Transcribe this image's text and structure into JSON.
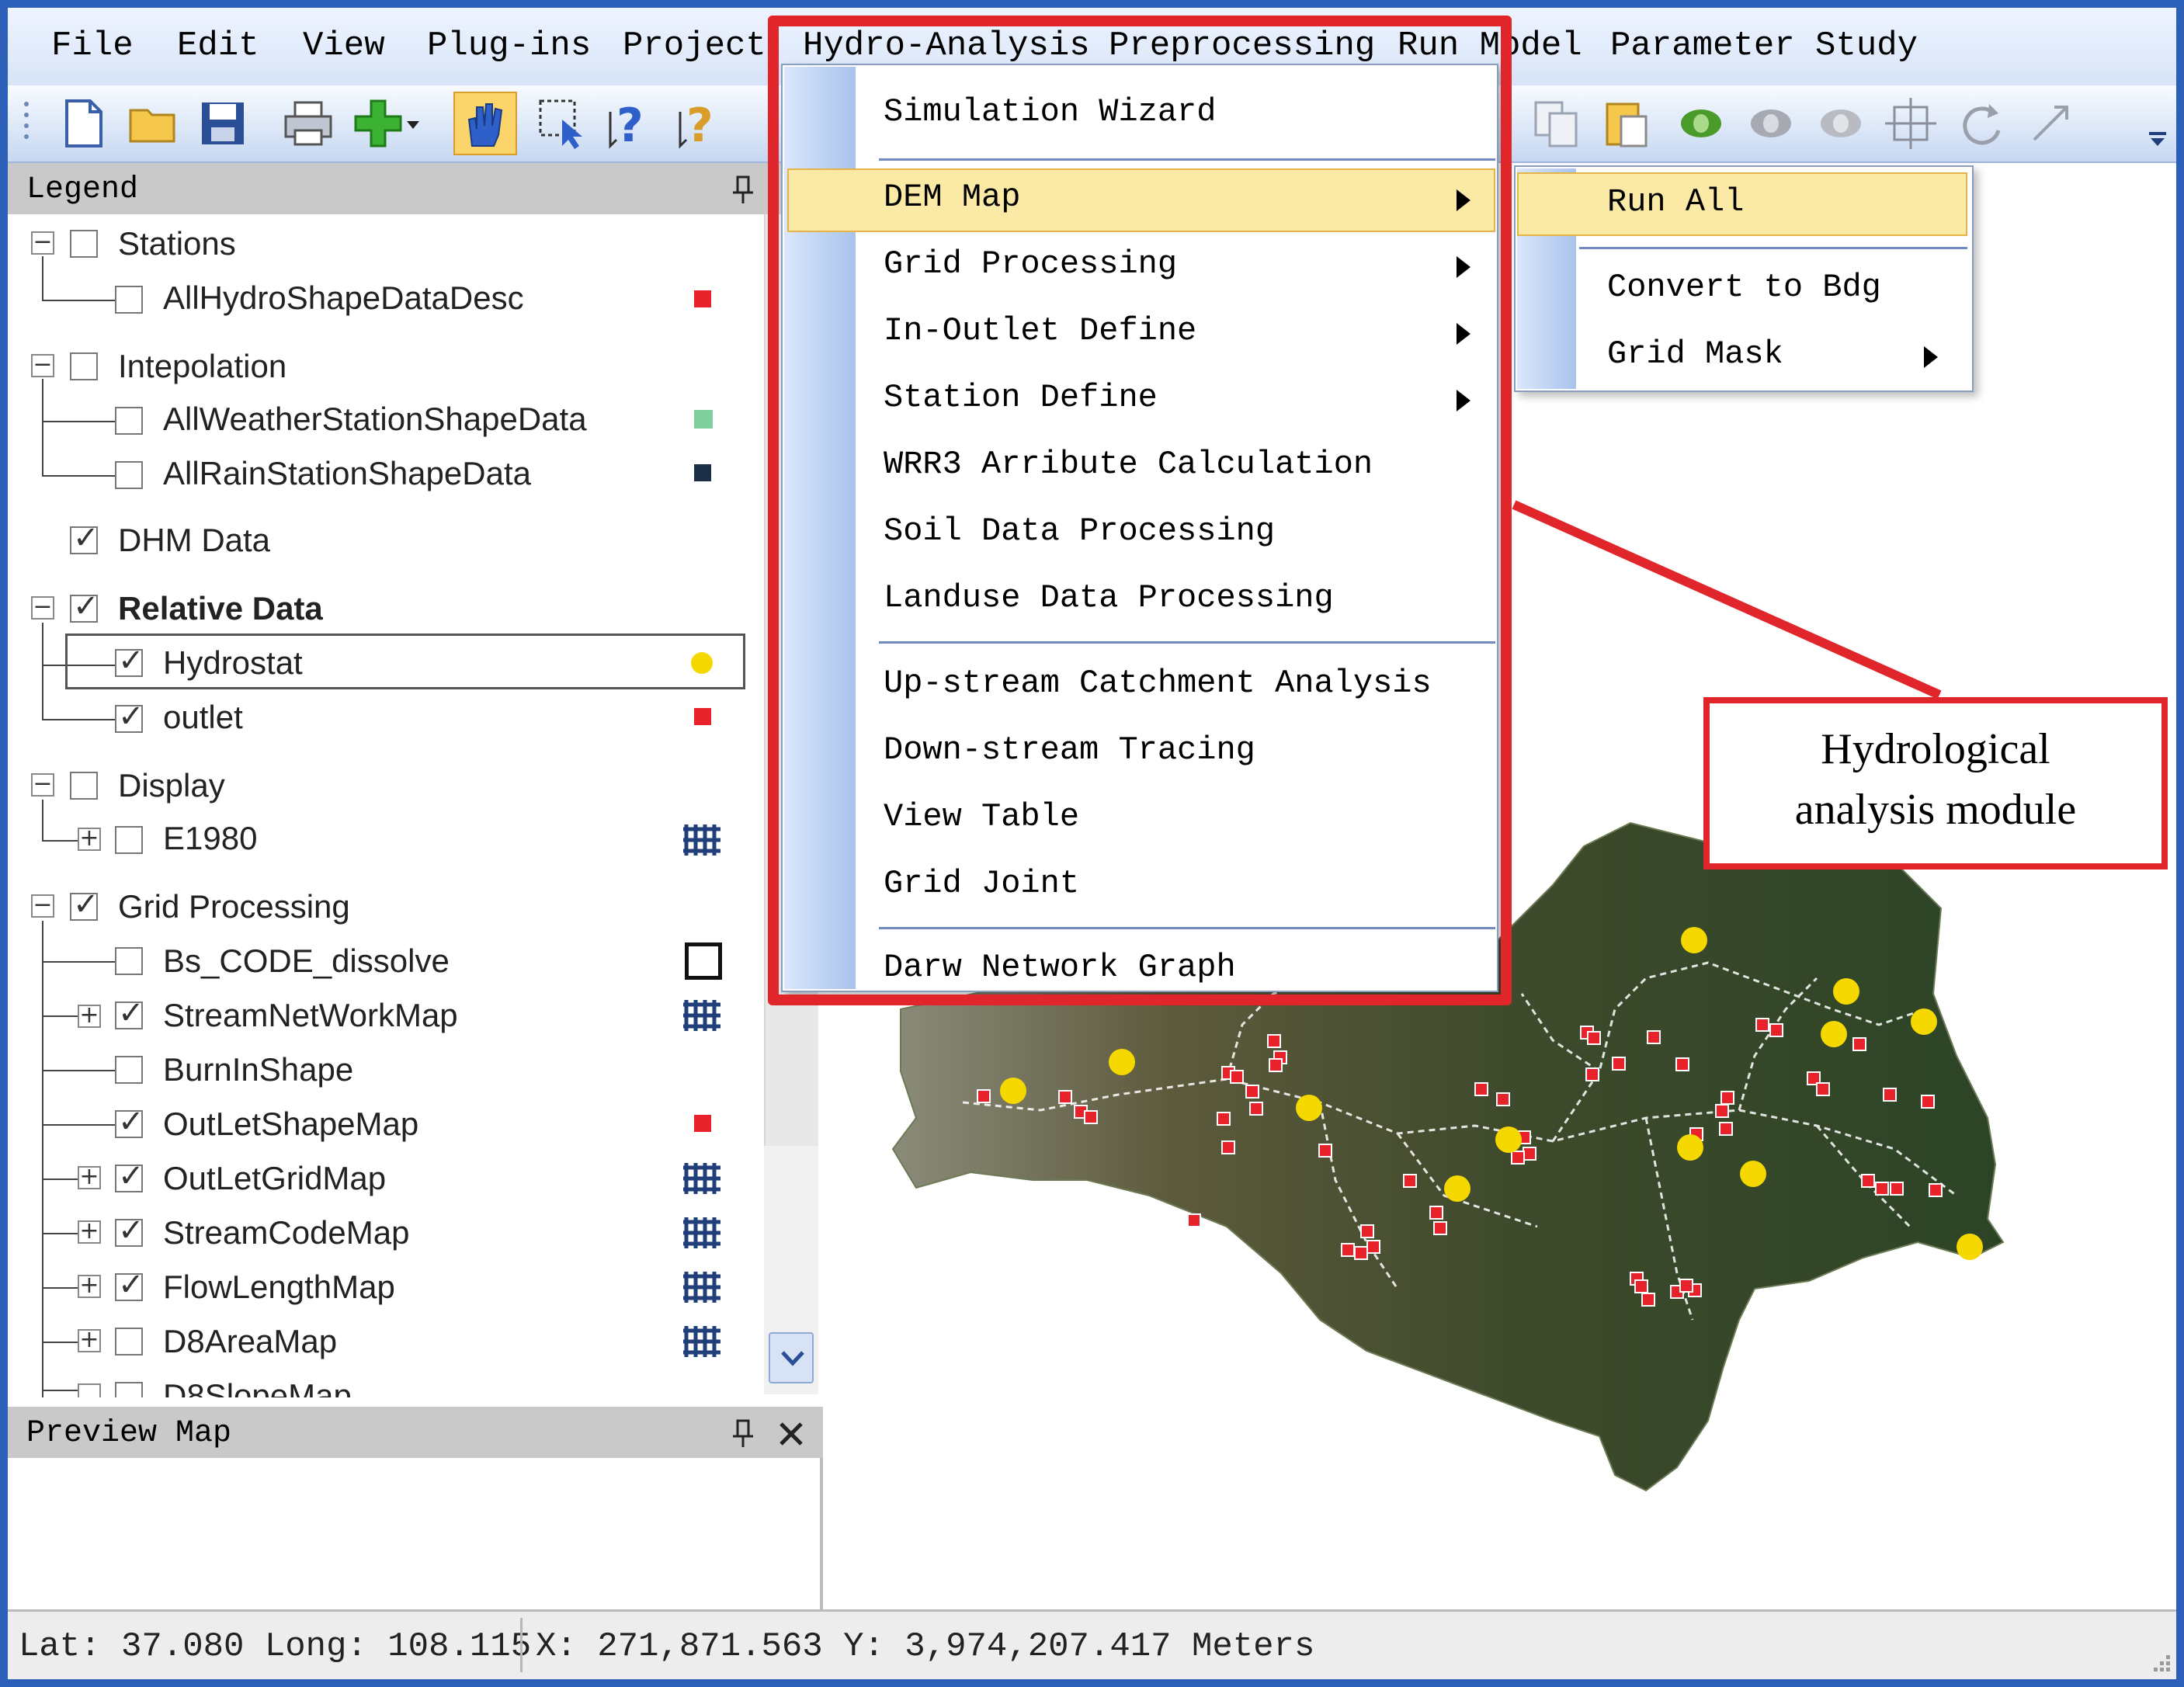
{
  "menubar": {
    "items": [
      "File",
      "Edit",
      "View",
      "Plug-ins",
      "Project",
      "Hydro-Analysis",
      "Preprocessing",
      "Run Model",
      "Parameter Study"
    ]
  },
  "legend": {
    "title": "Legend",
    "layers": {
      "stations": "Stations",
      "all_hydro": "AllHydroShapeDataDesc",
      "interpolation": "Intepolation",
      "all_weather": "AllWeatherStationShapeData",
      "all_rain": "AllRainStationShapeData",
      "dhm": "DHM Data",
      "relative": "Relative Data",
      "hydrostat": "Hydrostat",
      "outlet": "outlet",
      "display": "Display",
      "e1980": "E1980",
      "grid_processing": "Grid Processing",
      "bs_code": "Bs_CODE_dissolve",
      "stream_network": "StreamNetWorkMap",
      "burnin": "BurnInShape",
      "outlet_shape": "OutLetShapeMap",
      "outlet_grid": "OutLetGridMap",
      "stream_code": "StreamCodeMap",
      "flow_length": "FlowLengthMap",
      "d8area": "D8AreaMap",
      "d8slope": "D8SlopeMap"
    }
  },
  "preview": {
    "title": "Preview Map"
  },
  "dropdown": {
    "items": [
      "Simulation Wizard",
      "DEM Map",
      "Grid Processing",
      "In-Outlet Define",
      "Station Define",
      "WRR3 Arribute Calculation",
      "Soil Data Processing",
      "Landuse Data Processing",
      "Up-stream Catchment Analysis",
      "Down-stream Tracing",
      "View Table",
      "Grid Joint",
      "Darw Network Graph"
    ]
  },
  "submenu": {
    "items": [
      "Run All",
      "Convert to Bdg",
      "Grid Mask"
    ]
  },
  "annotation": {
    "line1": "Hydrological",
    "line2": "analysis module"
  },
  "status": {
    "latlong": "Lat: 37.080 Long: 108.115",
    "xy": "X: 271,871.563 Y: 3,974,207.417 Meters"
  },
  "colors": {
    "highlight_red": "#e0262b",
    "menu_highlight": "#fbeaa6",
    "station_red": "#e8222a",
    "station_yellow": "#f4d800",
    "terrain": "#3c4a2a"
  }
}
